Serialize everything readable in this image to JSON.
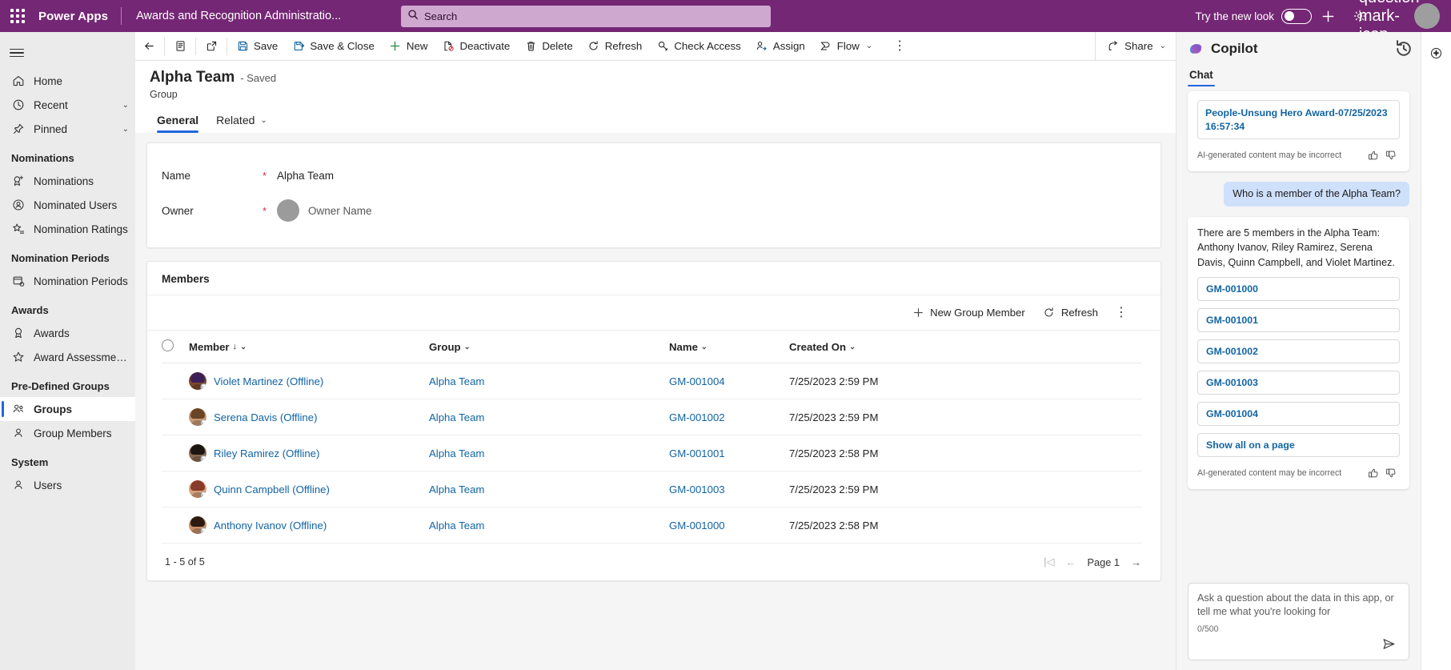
{
  "topbar": {
    "waffle_icon": "waffle-grid-icon",
    "brand": "Power Apps",
    "app_name": "Awards and Recognition Administratio...",
    "search": {
      "placeholder": "Search",
      "value": "",
      "icon": "search-icon"
    },
    "new_look_label": "Try the new look",
    "new_look_on": false,
    "plus_icon": "plus-icon",
    "gear_icon": "gear-icon",
    "help_icon": "question-mark-icon",
    "avatar": "user-avatar",
    "accent": "#742774"
  },
  "sidebar": {
    "hamburger_icon": "hamburger-icon",
    "top_items": [
      {
        "label": "Home",
        "icon": "home-icon",
        "chevron": false
      },
      {
        "label": "Recent",
        "icon": "clock-icon",
        "chevron": true
      },
      {
        "label": "Pinned",
        "icon": "pin-icon",
        "chevron": true
      }
    ],
    "groups": [
      {
        "title": "Nominations",
        "items": [
          {
            "label": "Nominations",
            "icon": "ribbon-plus-icon",
            "selected": false
          },
          {
            "label": "Nominated Users",
            "icon": "user-badge-icon",
            "selected": false
          },
          {
            "label": "Nomination Ratings",
            "icon": "star-list-icon",
            "selected": false
          }
        ]
      },
      {
        "title": "Nomination Periods",
        "items": [
          {
            "label": "Nomination Periods",
            "icon": "calendar-clock-icon",
            "selected": false
          }
        ]
      },
      {
        "title": "Awards",
        "items": [
          {
            "label": "Awards",
            "icon": "award-medal-icon",
            "selected": false
          },
          {
            "label": "Award Assessment R...",
            "icon": "star-icon",
            "selected": false
          }
        ]
      },
      {
        "title": "Pre-Defined Groups",
        "items": [
          {
            "label": "Groups",
            "icon": "people-icon",
            "selected": true
          },
          {
            "label": "Group Members",
            "icon": "person-icon",
            "selected": false
          }
        ]
      },
      {
        "title": "System",
        "items": [
          {
            "label": "Users",
            "icon": "person-icon",
            "selected": false
          }
        ]
      }
    ]
  },
  "commandbar": {
    "back_icon": "back-arrow-icon",
    "form_icon": "form-icon",
    "popout_icon": "pop-out-icon",
    "buttons": [
      {
        "label": "Save",
        "icon": "save-icon"
      },
      {
        "label": "Save & Close",
        "icon": "save-close-icon"
      },
      {
        "label": "New",
        "icon": "plus-icon"
      },
      {
        "label": "Deactivate",
        "icon": "deactivate-icon"
      },
      {
        "label": "Delete",
        "icon": "trash-icon"
      },
      {
        "label": "Refresh",
        "icon": "refresh-icon"
      },
      {
        "label": "Check Access",
        "icon": "key-icon"
      },
      {
        "label": "Assign",
        "icon": "assign-person-icon"
      },
      {
        "label": "Flow",
        "icon": "flow-icon",
        "chevron": true
      }
    ],
    "overflow_icon": "more-vertical-icon",
    "share_label": "Share",
    "share_icon": "share-icon"
  },
  "record": {
    "title": "Alpha Team",
    "saved_state": "- Saved",
    "entity": "Group",
    "tabs": [
      {
        "label": "General",
        "active": true,
        "chevron": false
      },
      {
        "label": "Related",
        "active": false,
        "chevron": true
      }
    ]
  },
  "form": {
    "fields": [
      {
        "label": "Name",
        "required": true,
        "value": "Alpha Team",
        "type": "text"
      },
      {
        "label": "Owner",
        "required": true,
        "value": "Owner Name",
        "type": "lookup-user"
      }
    ]
  },
  "subgrid": {
    "title": "Members",
    "toolbar": [
      {
        "label": "New Group Member",
        "icon": "plus-icon"
      },
      {
        "label": "Refresh",
        "icon": "refresh-icon"
      }
    ],
    "overflow_icon": "more-vertical-icon",
    "select_all_icon": "radio-unchecked-icon",
    "columns": [
      {
        "label": "Member",
        "sorted": true,
        "sort_dir": "down"
      },
      {
        "label": "Group",
        "sorted": false
      },
      {
        "label": "Name",
        "sorted": false
      },
      {
        "label": "Created On",
        "sorted": false
      }
    ],
    "rows": [
      {
        "member": "Violet Martinez (Offline)",
        "group": "Alpha Team",
        "name": "GM-001004",
        "created_on": "7/25/2023 2:59 PM",
        "avatar_skin": "#7a4a2e",
        "avatar_hair": "#3d1f58"
      },
      {
        "member": "Serena Davis (Offline)",
        "group": "Alpha Team",
        "name": "GM-001002",
        "created_on": "7/25/2023 2:59 PM",
        "avatar_skin": "#c89a76",
        "avatar_hair": "#6b4423"
      },
      {
        "member": "Riley Ramirez (Offline)",
        "group": "Alpha Team",
        "name": "GM-001001",
        "created_on": "7/25/2023 2:58 PM",
        "avatar_skin": "#8a6a52",
        "avatar_hair": "#1c1512"
      },
      {
        "member": "Quinn Campbell (Offline)",
        "group": "Alpha Team",
        "name": "GM-001003",
        "created_on": "7/25/2023 2:59 PM",
        "avatar_skin": "#d8a27c",
        "avatar_hair": "#8a3b2a"
      },
      {
        "member": "Anthony Ivanov (Offline)",
        "group": "Alpha Team",
        "name": "GM-001000",
        "created_on": "7/25/2023 2:58 PM",
        "avatar_skin": "#c98f68",
        "avatar_hair": "#2a1a12"
      }
    ],
    "footer": {
      "count_text": "1 - 5 of 5",
      "first_icon": "page-first-icon",
      "prev_icon": "page-prev-icon",
      "page_label": "Page 1",
      "next_icon": "page-next-icon"
    }
  },
  "copilot": {
    "logo_icon": "copilot-logo-icon",
    "title": "Copilot",
    "history_icon": "history-icon",
    "tabs": [
      {
        "label": "Chat",
        "active": true
      }
    ],
    "first_card": {
      "reference": "People-Unsung Hero Award-07/25/2023 16:57:34",
      "disclaimer": "AI-generated content may be incorrect",
      "thumbs_up_icon": "thumbs-up-icon",
      "thumbs_down_icon": "thumbs-down-icon"
    },
    "user_message": "Who is a member of the Alpha Team?",
    "answer_card": {
      "text": "There are 5 members in the Alpha Team: Anthony Ivanov, Riley Ramirez, Serena Davis, Quinn Campbell, and Violet Martinez.",
      "chips": [
        "GM-001000",
        "GM-001001",
        "GM-001002",
        "GM-001003",
        "GM-001004",
        "Show all on a page"
      ],
      "disclaimer": "AI-generated content may be incorrect",
      "thumbs_up_icon": "thumbs-up-icon",
      "thumbs_down_icon": "thumbs-down-icon"
    },
    "input": {
      "placeholder": "Ask a question about the data in this app, or tell me what you're looking for",
      "value": "",
      "counter": "0/500",
      "send_icon": "send-icon"
    }
  },
  "rail": {
    "items": [
      {
        "icon": "copilot-sparkle-icon"
      }
    ]
  }
}
